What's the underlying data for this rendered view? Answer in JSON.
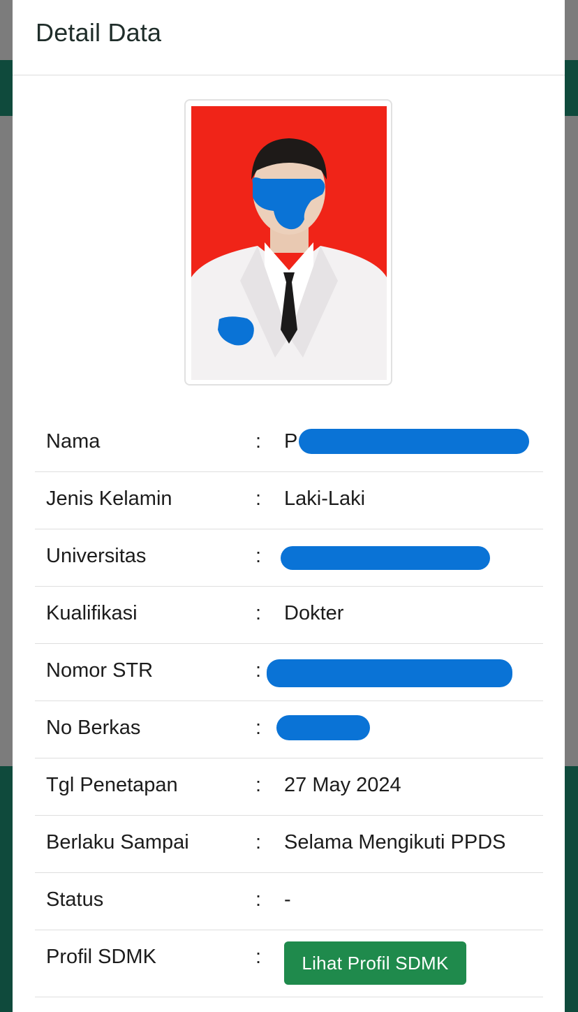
{
  "modal": {
    "title": "Detail Data"
  },
  "photo": {
    "alt": "Foto profil",
    "background_color": "#f02418"
  },
  "details": {
    "rows": [
      {
        "label": "Nama",
        "colon": ":",
        "value": "P",
        "redacted": true
      },
      {
        "label": "Jenis Kelamin",
        "colon": ":",
        "value": "Laki-Laki"
      },
      {
        "label": "Universitas",
        "colon": ":",
        "value": "",
        "redacted": true
      },
      {
        "label": "Kualifikasi",
        "colon": ":",
        "value": "Dokter"
      },
      {
        "label": "Nomor STR",
        "colon": ":",
        "value": "",
        "redacted": true
      },
      {
        "label": "No Berkas",
        "colon": ":",
        "value": "",
        "redacted": true
      },
      {
        "label": "Tgl Penetapan",
        "colon": ":",
        "value": "27 May 2024"
      },
      {
        "label": "Berlaku Sampai",
        "colon": ":",
        "value": "Selama Mengikuti PPDS"
      },
      {
        "label": "Status",
        "colon": ":",
        "value": "-"
      },
      {
        "label": "Profil SDMK",
        "colon": ":",
        "button_label": "Lihat Profil SDMK"
      }
    ]
  },
  "colors": {
    "accent_green": "#1f8a4c",
    "header_band": "#0f4a3c",
    "redaction_blue": "#0a73d6"
  }
}
